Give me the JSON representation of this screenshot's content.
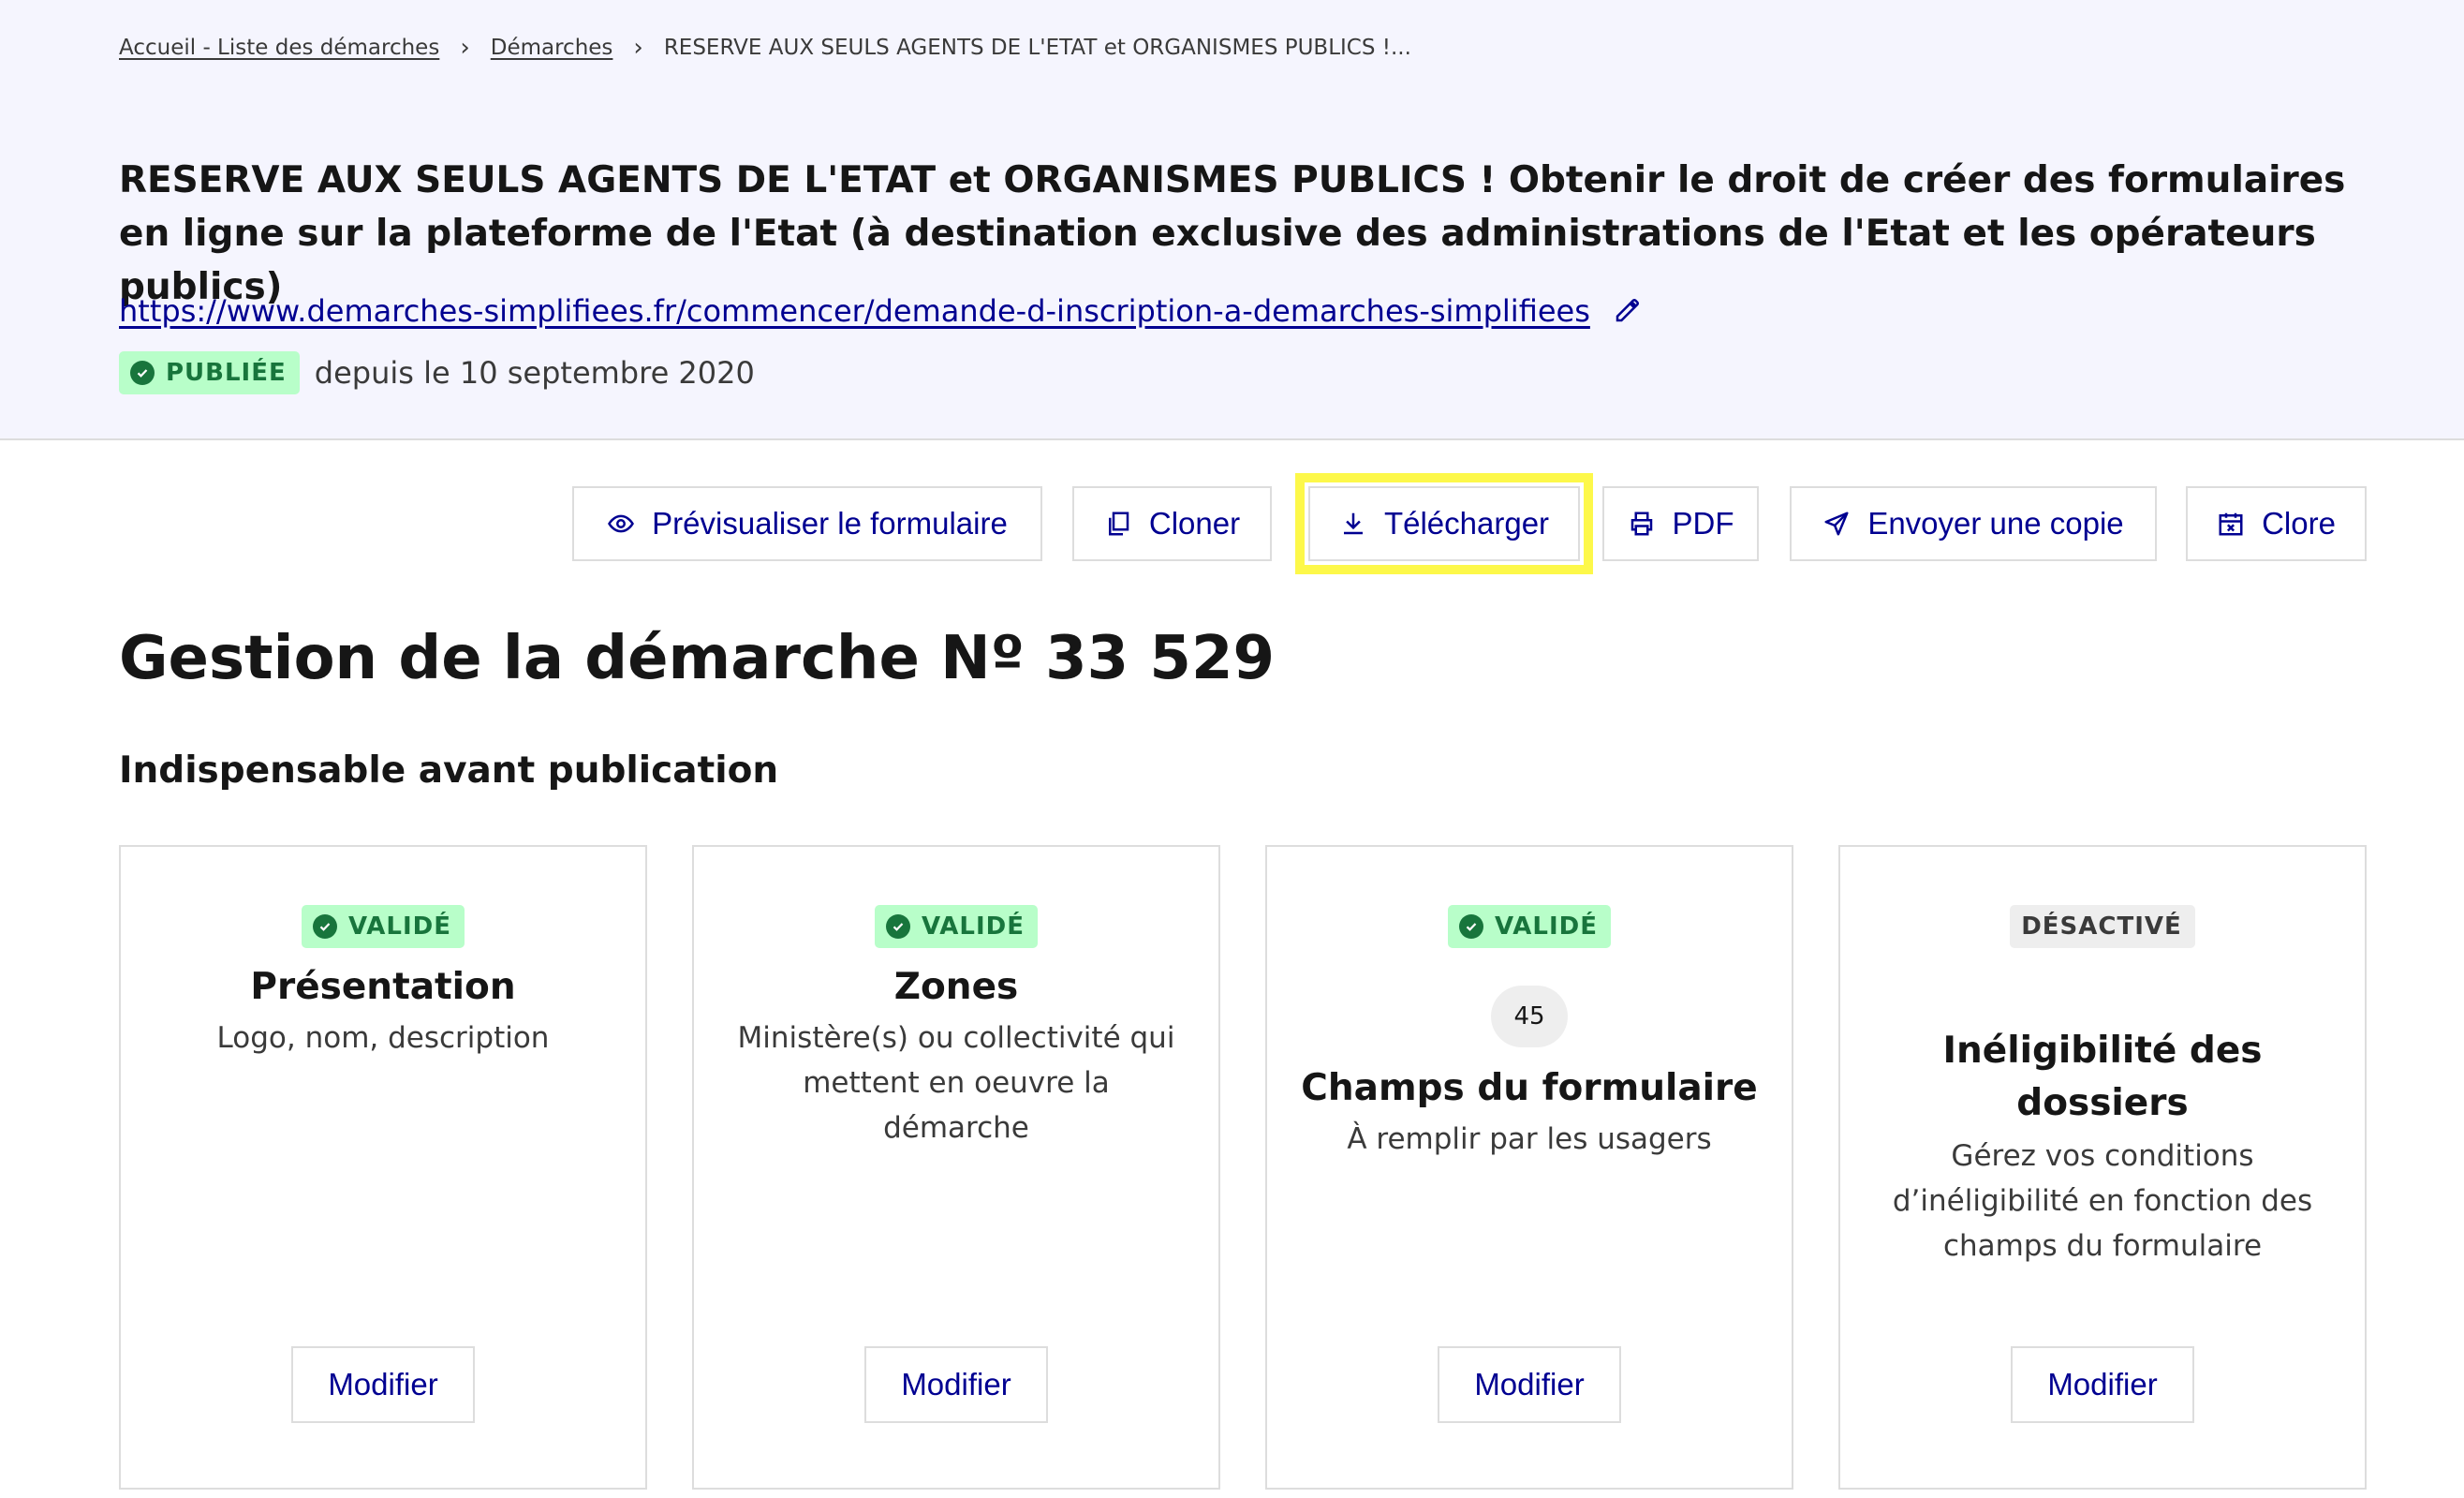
{
  "breadcrumb": {
    "home": "Accueil - Liste des démarches",
    "demarches": "Démarches",
    "current": "RESERVE AUX SEULS AGENTS DE L'ETAT et ORGANISMES PUBLICS !..."
  },
  "header": {
    "title": "RESERVE AUX SEULS AGENTS DE L'ETAT et ORGANISMES PUBLICS ! Obtenir le droit de créer des formulaires en ligne sur la plateforme de l'Etat (à destination exclusive des administrations de l'Etat et les opérateurs publics)",
    "url": "https://www.demarches-simplifiees.fr/commencer/demande-d-inscription-a-demarches-simplifiees",
    "status_badge": "PUBLIÉE",
    "status_since": "depuis le 10 septembre 2020"
  },
  "toolbar": {
    "preview": "Prévisualiser le formulaire",
    "clone": "Cloner",
    "download": "Télécharger",
    "pdf": "PDF",
    "send_copy": "Envoyer une copie",
    "close": "Clore"
  },
  "main": {
    "title": "Gestion de la démarche Nº 33 529",
    "section_title": "Indispensable avant publication",
    "cards": [
      {
        "badge": "VALIDÉ",
        "title": "Présentation",
        "description": "Logo, nom, description",
        "button": "Modifier"
      },
      {
        "badge": "VALIDÉ",
        "title": "Zones",
        "description": "Ministère(s) ou collectivité qui mettent en oeuvre la démarche",
        "button": "Modifier"
      },
      {
        "badge": "VALIDÉ",
        "count": "45",
        "title": "Champs du formulaire",
        "description": "À remplir par les usagers",
        "button": "Modifier"
      },
      {
        "badge": "DÉSACTIVÉ",
        "title": "Inéligibilité des dossiers",
        "description": "Gérez vos conditions d’inéligibilité en fonction des champs du formulaire",
        "button": "Modifier"
      }
    ]
  },
  "colors": {
    "header_bg": "#f5f5fe",
    "primary_blue": "#000091",
    "success_bg": "#b8fec9",
    "success_fg": "#18753c",
    "highlight_yellow": "#fdf84a"
  }
}
